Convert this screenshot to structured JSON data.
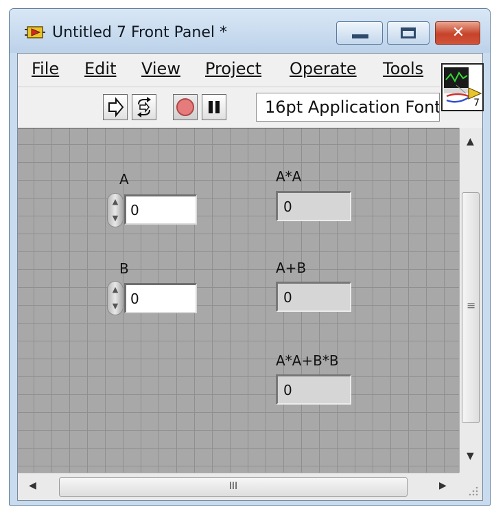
{
  "window": {
    "title": "Untitled 7 Front Panel *",
    "buttons": {
      "minimize": "minimize",
      "maximize": "maximize",
      "close": "✕"
    }
  },
  "menu": {
    "items": [
      {
        "label": "File"
      },
      {
        "label": "Edit"
      },
      {
        "label": "View"
      },
      {
        "label": "Project"
      },
      {
        "label": "Operate"
      },
      {
        "label": "Tools"
      }
    ]
  },
  "toolbar": {
    "run_icon": "run-arrow-icon",
    "run_continuous_icon": "run-continuously-icon",
    "abort_icon": "abort-execution-icon",
    "pause_icon": "pause-icon",
    "font_select": "16pt Application Font"
  },
  "vi_icon": {
    "number": "7"
  },
  "panel": {
    "controls": [
      {
        "label": "A",
        "value": "0"
      },
      {
        "label": "B",
        "value": "0"
      }
    ],
    "indicators": [
      {
        "label": "A*A",
        "value": "0"
      },
      {
        "label": "A+B",
        "value": "0"
      },
      {
        "label": "A*A+B*B",
        "value": "0"
      }
    ]
  },
  "scrollbars": {
    "hthumb_grip": "III",
    "vthumb_grip": "≡"
  },
  "colors": {
    "panel_bg": "#a8a8a8",
    "grid": "#8f8f8f",
    "close_button": "#c6432a",
    "titlebar": "#c9dcef"
  }
}
